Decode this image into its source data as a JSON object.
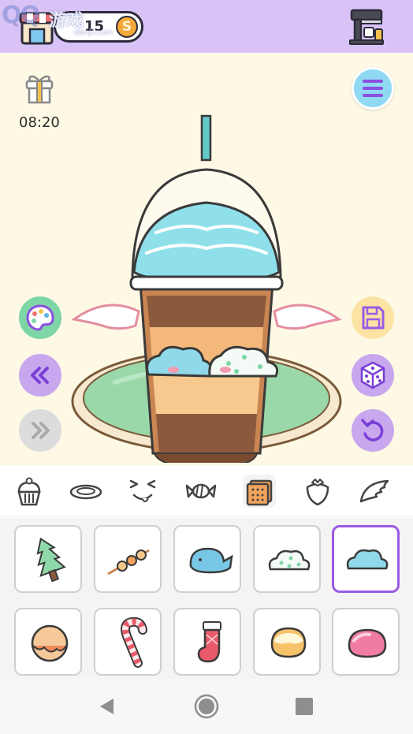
{
  "header": {
    "coin_count": "15",
    "coin_symbol": "S",
    "watermark_logo": "QQ",
    "watermark_text": "游戏",
    "watermark_url": "danji.com",
    "shop_icon": "shop-stall-icon",
    "machine_icon": "coffee-machine-icon"
  },
  "stage": {
    "gift_icon": "gift-box-icon",
    "timer": "08:20",
    "background_color": "#fdf9e5",
    "left_buttons": [
      {
        "name": "palette-button",
        "icon": "palette-icon",
        "color": "#7ed6a6"
      },
      {
        "name": "previous-button",
        "icon": "double-chevron-left-icon",
        "color": "#c9a7ee"
      },
      {
        "name": "next-button",
        "icon": "double-chevron-right-icon",
        "color": "#dcdcdc"
      }
    ],
    "right_buttons": [
      {
        "name": "menu-button",
        "icon": "hamburger-menu-icon",
        "color": "#8fd9f2"
      },
      {
        "name": "save-button",
        "icon": "floppy-disk-icon",
        "color": "#fbe3a3"
      },
      {
        "name": "random-button",
        "icon": "dice-icon",
        "color": "#c9a7ee"
      },
      {
        "name": "undo-button",
        "icon": "undo-arrow-icon",
        "color": "#c9a7ee"
      }
    ]
  },
  "categories": [
    {
      "name": "cupcake",
      "icon": "cupcake-icon"
    },
    {
      "name": "plate",
      "icon": "plate-icon"
    },
    {
      "name": "face",
      "icon": "face-expression-icon"
    },
    {
      "name": "candy",
      "icon": "wrapped-candy-icon"
    },
    {
      "name": "biscuit",
      "icon": "biscuit-icon",
      "active": true
    },
    {
      "name": "strawberry",
      "icon": "strawberry-icon"
    },
    {
      "name": "wings",
      "icon": "wing-icon"
    }
  ],
  "items": [
    {
      "name": "tree",
      "icon": "christmas-tree-icon"
    },
    {
      "name": "skewer",
      "icon": "dango-skewer-icon"
    },
    {
      "name": "whale",
      "icon": "whale-icon"
    },
    {
      "name": "dotted-cloud",
      "icon": "dotted-cloud-icon"
    },
    {
      "name": "blue-cloud",
      "icon": "blue-cloud-icon",
      "selected": true
    },
    {
      "name": "cookie-ball",
      "icon": "cookie-ball-icon"
    },
    {
      "name": "candy-cane",
      "icon": "candy-cane-icon"
    },
    {
      "name": "stocking",
      "icon": "stocking-icon"
    },
    {
      "name": "cream-puff",
      "icon": "cream-puff-icon"
    },
    {
      "name": "pink-mochi",
      "icon": "pink-mochi-icon"
    }
  ],
  "colors": {
    "topbar": "#d8c2f6",
    "accent_purple": "#9a5ae6",
    "coin": "#f4a93b"
  },
  "navbar": {
    "back_icon": "nav-back-triangle-icon",
    "home_icon": "nav-home-circle-icon",
    "recent_icon": "nav-recent-square-icon"
  }
}
